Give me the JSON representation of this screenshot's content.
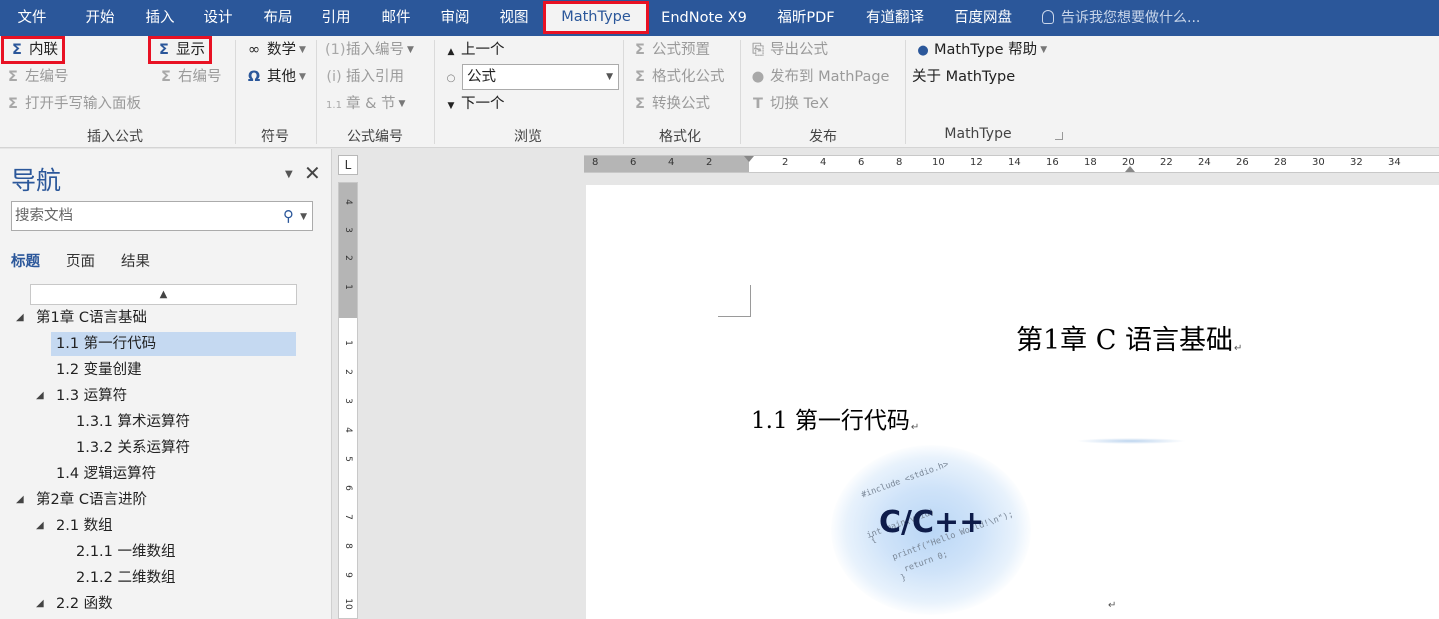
{
  "tabs": [
    "文件",
    "开始",
    "插入",
    "设计",
    "布局",
    "引用",
    "邮件",
    "审阅",
    "视图",
    "MathType",
    "EndNote X9",
    "福昕PDF",
    "有道翻译",
    "百度网盘"
  ],
  "active_tab": "MathType",
  "tell_me": "告诉我您想要做什么...",
  "ribbon": {
    "insert_equation": {
      "inline": "内联",
      "display": "显示",
      "left_number": "左编号",
      "right_number": "右编号",
      "handwriting": "打开手写输入面板",
      "label": "插入公式"
    },
    "symbols": {
      "math": "数学",
      "other": "其他",
      "label": "符号"
    },
    "equation_numbers": {
      "insert_number": "插入编号",
      "insert_reference": "插入引用",
      "chapter_section": "章 & 节",
      "label": "公式编号"
    },
    "browse": {
      "previous": "上一个",
      "selected": "公式",
      "next": "下一个",
      "label": "浏览"
    },
    "format": {
      "preset": "公式预置",
      "format_equations": "格式化公式",
      "convert": "转换公式",
      "label": "格式化"
    },
    "publish": {
      "export": "导出公式",
      "publish_mathpage": "发布到 MathPage",
      "toggle_tex": "切换 TeX",
      "label": "发布"
    },
    "mathtype": {
      "help": "MathType 帮助",
      "about": "关于 MathType",
      "label": "MathType"
    }
  },
  "nav": {
    "title": "导航",
    "search_placeholder": "搜索文档",
    "tabs": [
      "标题",
      "页面",
      "结果"
    ],
    "items": [
      "第1章 C语言基础",
      "1.1 第一行代码",
      "1.2 变量创建",
      "1.3 运算符",
      "1.3.1 算术运算符",
      "1.3.2 关系运算符",
      "1.4 逻辑运算符",
      "第2章 C语言进阶",
      "2.1 数组",
      "2.1.1 一维数组",
      "2.1.2 二维数组",
      "2.2 函数"
    ]
  },
  "ruler": {
    "h": [
      "8",
      "6",
      "4",
      "2",
      "2",
      "4",
      "6",
      "8",
      "10",
      "12",
      "14",
      "16",
      "18",
      "20",
      "22",
      "24",
      "26",
      "28",
      "30",
      "32",
      "34"
    ],
    "v": [
      "4",
      "3",
      "2",
      "1",
      "1",
      "2",
      "3",
      "4",
      "5",
      "6",
      "7",
      "8",
      "9",
      "10"
    ],
    "corner": "L"
  },
  "document": {
    "chapter_title": "第1章  C 语言基础",
    "section_title": "1.1 第一行代码",
    "logo_text": "C/C++",
    "logo_code": [
      "#include <stdio.h>",
      "int main(void)",
      "{",
      "printf(\"Hello World!\\n\");",
      "return 0;",
      "}"
    ],
    "para_mark": "↵"
  }
}
